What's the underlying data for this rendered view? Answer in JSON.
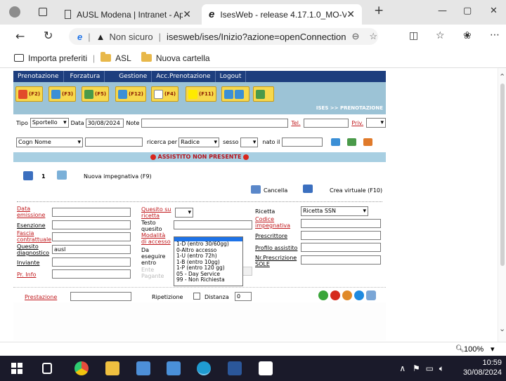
{
  "browser": {
    "tabs": [
      {
        "title": "AUSL Modena | Intranet - Applic",
        "close": "✕"
      },
      {
        "title": "IsesWeb - release 4.17.1.0_MO-V",
        "close": "✕"
      }
    ],
    "new_tab": "+",
    "security_label": "Non sicuro",
    "url": "isesweb/ises/Inizio?azione=openConnection",
    "favorites": [
      {
        "label": "Importa preferiti"
      },
      {
        "label": "ASL"
      },
      {
        "label": "Nuova cartella"
      }
    ],
    "zoom": "100%"
  },
  "app": {
    "menu": [
      "Prenotazione",
      "Forzatura",
      "Gestione",
      "Acc.Prenotazione",
      "Logout"
    ],
    "toolbar_keys": [
      "(F2)",
      "(F3)",
      "(F5)",
      "(F12)",
      "(F4)",
      "(F11)"
    ],
    "breadcrumb": "ISES >> PRENOTAZIONE",
    "row1": {
      "tipo_label": "Tipo",
      "tipo_value": "Sportello",
      "data_label": "Data",
      "data_value": "30/08/2024",
      "note_label": "Note",
      "tel_label": "Tel.",
      "priv_label": "Priv."
    },
    "row2": {
      "search_field": "Cogn Nome",
      "ricerca_label": "ricerca per",
      "ricerca_value": "Radice",
      "sesso_label": "sesso",
      "nato_label": "nato il"
    },
    "assist_banner": "ASSISTITO NON PRESENTE",
    "tab_number": "1",
    "nuova_impegnativa": "Nuova impegnativa (F9)",
    "cancella": "Cancella",
    "crea_virtuale": "Crea virtuale (F10)",
    "form": {
      "data_emissione": "Data emissione",
      "esenzione": "Esenzione",
      "fascia": "Fascia contrattuale",
      "quesito_diagnostico": "Quesito diagnostico",
      "quesito_value": "ausl",
      "inviante": "Inviante",
      "pr_info": "Pr. Info",
      "quesito_ricetta": "Quesito su ricetta",
      "testo_quesito": "Testo quesito",
      "modalita_accesso": "Modalità di accesso",
      "da_eseguire": "Da eseguire entro",
      "ente_pagante": "Ente Pagante",
      "ricetta": "Ricetta",
      "ricetta_value": "Ricetta SSN",
      "codice_impegnativa": "Codice impegnativa",
      "prescrittore": "Prescrittore",
      "profilo_assistito": "Profilo assistito",
      "nr_prescrizione": "Nr.Prescrizione SOLE"
    },
    "modalita_options": [
      "1-D (entro 30/60gg)",
      "0-Altro accesso",
      "1-U (entro 72h)",
      "1-B (entro 10gg)",
      "1-P (entro 120 gg)",
      "05 - Day Service",
      "99 - Non Richiesta"
    ],
    "prestazione": "Prestazione",
    "ripetizione": "Ripetizione",
    "distanza": "Distanza",
    "distanza_value": "0"
  },
  "taskbar": {
    "time": "10:59",
    "date": "30/08/2024"
  }
}
